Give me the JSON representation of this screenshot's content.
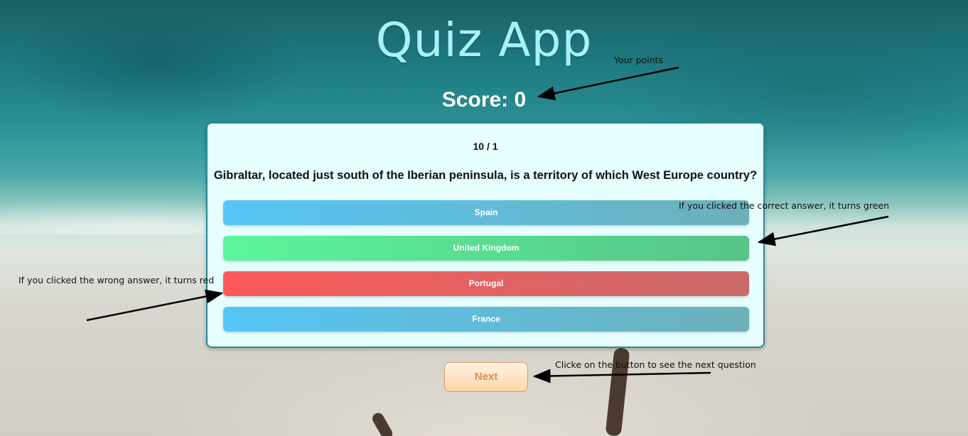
{
  "header": {
    "title": "Quiz App",
    "score": "Score: 0"
  },
  "quiz": {
    "counter": "10 / 1",
    "question": "Gibraltar, located just south of the Iberian peninsula, is a territory of which West Europe country?",
    "answers": [
      {
        "label": "Spain",
        "state": "neutral"
      },
      {
        "label": "United Kingdom",
        "state": "correct"
      },
      {
        "label": "Portugal",
        "state": "wrong"
      },
      {
        "label": "France",
        "state": "neutral"
      }
    ],
    "next_label": "Next"
  },
  "annotations": {
    "points": "Your points",
    "correct": "If you clicked the correct answer, it turns green",
    "wrong": "If you clicked the wrong answer, it turns red",
    "next": "Clicke on the button to see the next question"
  },
  "colors": {
    "title": "#a8f1f6",
    "card_bg": "#e6fefe",
    "card_border": "#2a8a98",
    "neutral_answer": "#56c6f6",
    "correct_answer": "#5cf59d",
    "wrong_answer": "#fb5a5a",
    "next_button": "#fcd5a8"
  }
}
